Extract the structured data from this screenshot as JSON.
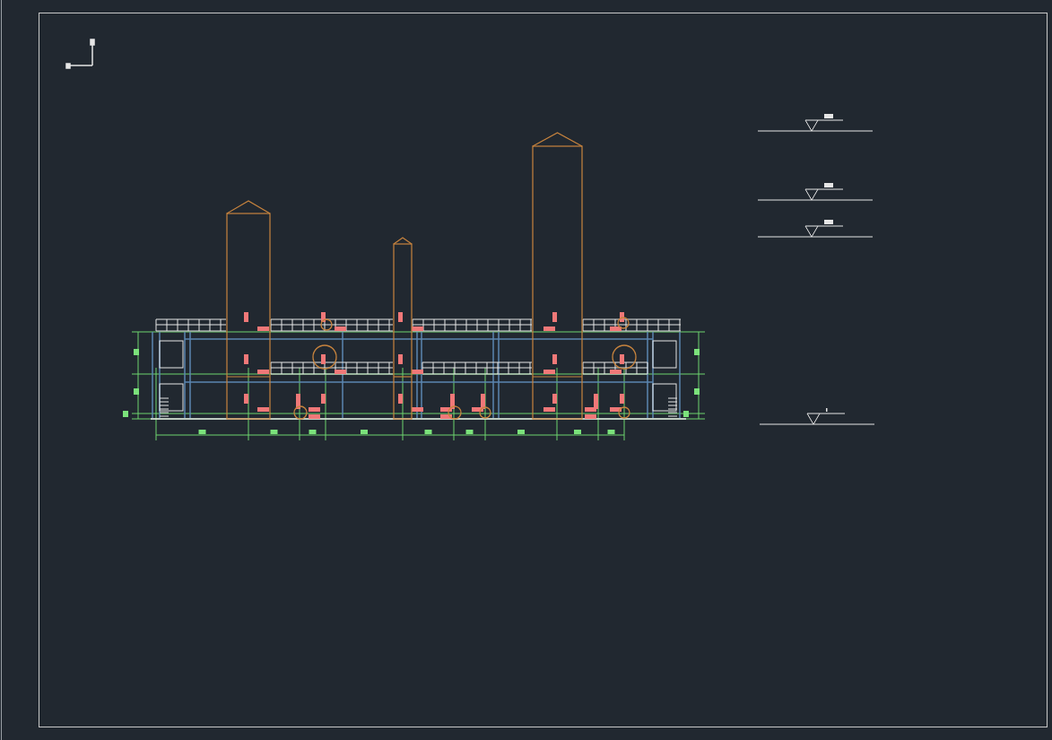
{
  "towers": [
    {
      "kind": "column"
    },
    {
      "kind": "column"
    },
    {
      "kind": "column"
    }
  ],
  "level_marks": [
    {
      "kind": "elevation"
    },
    {
      "kind": "elevation"
    },
    {
      "kind": "elevation"
    },
    {
      "kind": "ground"
    }
  ]
}
